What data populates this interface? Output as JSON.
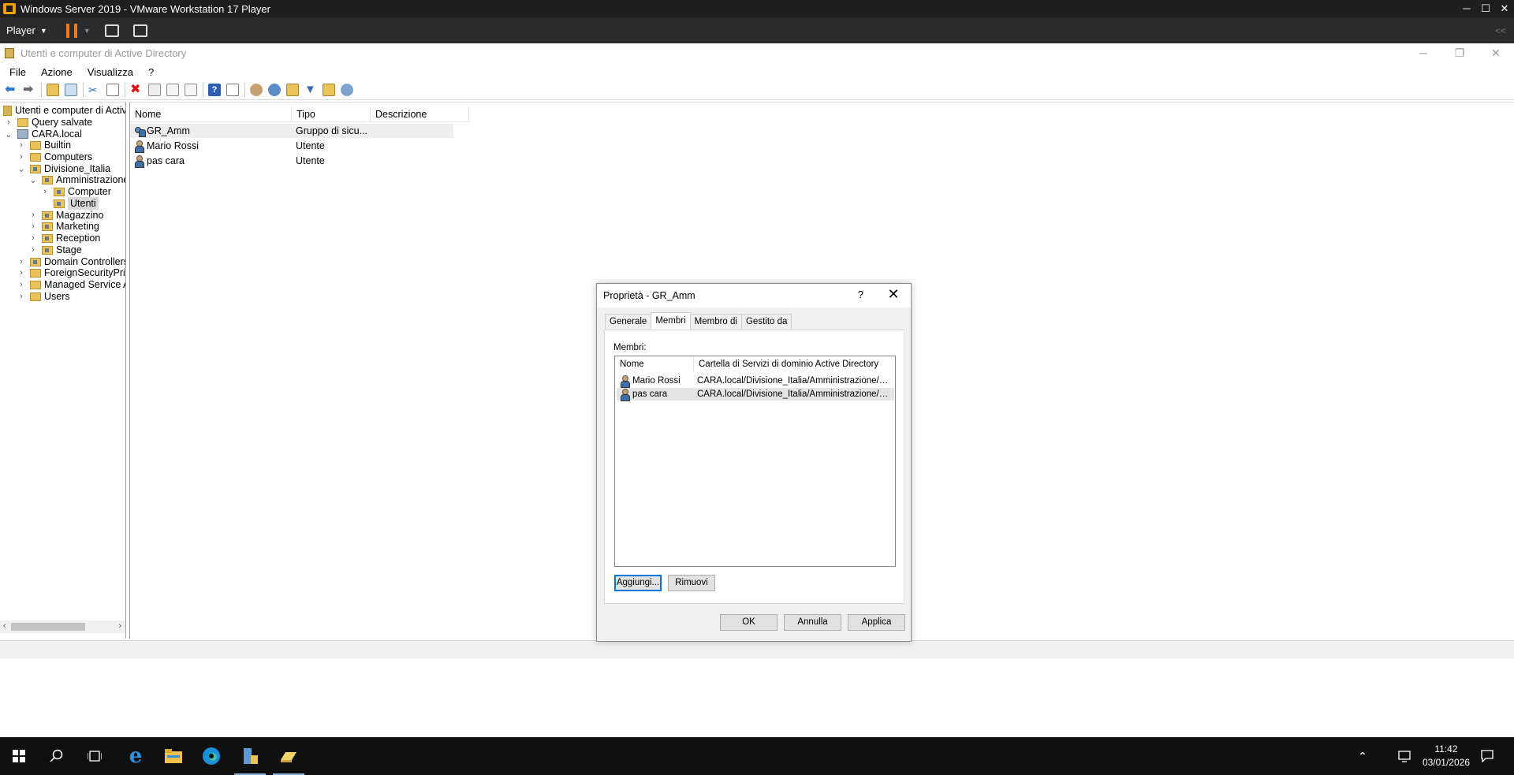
{
  "vm": {
    "title": "Windows Server 2019 - VMware Workstation 17 Player",
    "player_menu": "Player",
    "controls": {
      "minimize": "─",
      "maximize": "☐",
      "close": "✕"
    },
    "collapse": "<<"
  },
  "mmc": {
    "title": "Utenti e computer di Active Directory",
    "menu": [
      "File",
      "Azione",
      "Visualizza",
      "?"
    ],
    "controls": {
      "minimize": "─",
      "restore": "❐",
      "close": "✕"
    }
  },
  "tree": {
    "root": "Utenti e computer di Active Directory",
    "nodes": [
      {
        "label": "Query salvate",
        "expander": "›"
      },
      {
        "label": "CARA.local",
        "expander": "⌄"
      },
      {
        "label": "Builtin",
        "expander": "›"
      },
      {
        "label": "Computers",
        "expander": "›"
      },
      {
        "label": "Divisione_Italia",
        "expander": "⌄"
      },
      {
        "label": "Amministrazione",
        "expander": "⌄"
      },
      {
        "label": "Computer",
        "expander": "›"
      },
      {
        "label": "Utenti",
        "expander": ""
      },
      {
        "label": "Magazzino",
        "expander": "›"
      },
      {
        "label": "Marketing",
        "expander": "›"
      },
      {
        "label": "Reception",
        "expander": "›"
      },
      {
        "label": "Stage",
        "expander": "›"
      },
      {
        "label": "Domain Controllers",
        "expander": "›"
      },
      {
        "label": "ForeignSecurityPrincipals",
        "expander": "›"
      },
      {
        "label": "Managed Service Accounts",
        "expander": "›"
      },
      {
        "label": "Users",
        "expander": "›"
      }
    ]
  },
  "list": {
    "columns": [
      "Nome",
      "Tipo",
      "Descrizione"
    ],
    "rows": [
      {
        "name": "GR_Amm",
        "type": "Gruppo di sicu...",
        "icon": "group-icon"
      },
      {
        "name": "Mario Rossi",
        "type": "Utente",
        "icon": "user-icon"
      },
      {
        "name": "pas cara",
        "type": "Utente",
        "icon": "user-icon"
      }
    ]
  },
  "dialog": {
    "title": "Proprietà - GR_Amm",
    "help": "?",
    "close": "✕",
    "tabs": [
      "Generale",
      "Membri",
      "Membro di",
      "Gestito da"
    ],
    "active_tab": "Membri",
    "members_label": "Membri:",
    "columns": [
      "Nome",
      "Cartella di Servizi di dominio Active Directory"
    ],
    "members": [
      {
        "name": "Mario Rossi",
        "path": "CARA.local/Divisione_Italia/Amministrazione/Utenti"
      },
      {
        "name": "pas cara",
        "path": "CARA.local/Divisione_Italia/Amministrazione/Utenti"
      }
    ],
    "add_button": "Aggiungi...",
    "remove_button": "Rimuovi",
    "ok_button": "OK",
    "cancel_button": "Annulla",
    "apply_button": "Applica"
  },
  "taskbar": {
    "time": "11:42",
    "date": "03/01/2026"
  },
  "colors": {
    "accent": "#0078d7",
    "vm_pause": "#f07b1c"
  }
}
